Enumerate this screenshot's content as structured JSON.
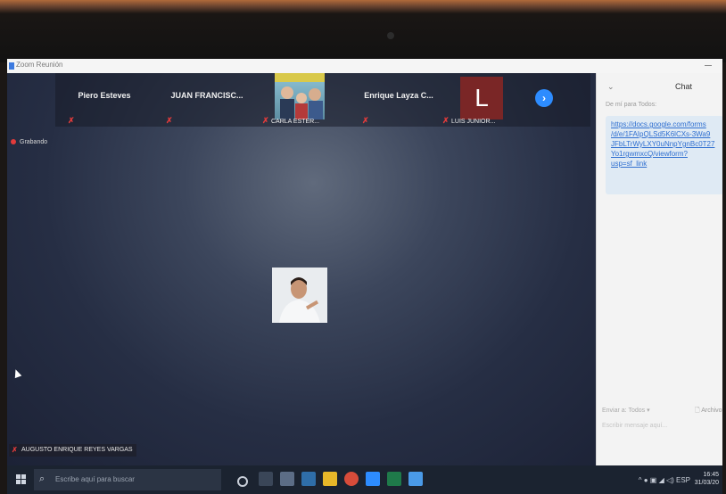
{
  "window": {
    "title": "Zoom Reunión"
  },
  "participants": [
    {
      "name": "Piero Esteves"
    },
    {
      "name": "JUAN FRANCISC..."
    },
    {
      "name": "CARLA ESTER..."
    },
    {
      "name": "Enrique Layza C..."
    },
    {
      "name": "LUIS JUNIOR...",
      "initial": "L"
    }
  ],
  "recording": {
    "label": "Grabando"
  },
  "active_speaker": {
    "name": "AUGUSTO ENRIQUE REYES VARGAS"
  },
  "chat": {
    "title": "Chat",
    "from": "De mí para Todos:",
    "message_lines": [
      "https://docs.google.com/forms",
      "/d/e/1FAIpQLSd5K6lCXs-3Wa9",
      "JFbLTrWyLXY0uNnpYgnBc0T27",
      "Yo1rgwmxcQ/viewform?",
      "usp=sf_link"
    ],
    "to_label": "Enviar a:",
    "to_value": "Todos",
    "file_label": "Archivo",
    "input_placeholder": "Escribir mensaje aquí..."
  },
  "taskbar": {
    "search_placeholder": "Escribe aquí para buscar",
    "language": "ESP",
    "time": "16:45",
    "date": "31/03/20"
  },
  "colors": {
    "accent": "#2d8cff",
    "muted_icon": "#e23b3b",
    "avatar_bg": "#7a2626"
  },
  "icons": [
    "zoom-icon",
    "muted-mic-icon",
    "next-page-icon",
    "record-icon",
    "windows-start-icon",
    "search-icon"
  ]
}
